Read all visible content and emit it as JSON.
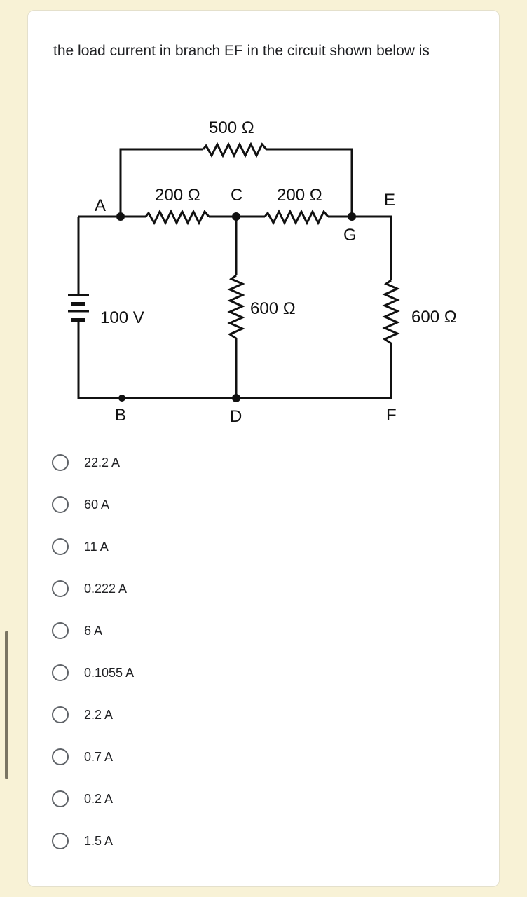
{
  "question": {
    "text": "the load current in branch EF in the circuit shown below is"
  },
  "circuit": {
    "source": {
      "label": "100 V"
    },
    "resistors": {
      "top": "500 Ω",
      "ac": "200 Ω",
      "cg": "200 Ω",
      "cd": "600 Ω",
      "ef": "600 Ω"
    },
    "nodes": {
      "a": "A",
      "b": "B",
      "c": "C",
      "d": "D",
      "e": "E",
      "f": "F",
      "g": "G"
    }
  },
  "options": [
    {
      "label": "22.2 A",
      "selected": false
    },
    {
      "label": "60 A",
      "selected": false
    },
    {
      "label": "11 A",
      "selected": false
    },
    {
      "label": "0.222 A",
      "selected": false
    },
    {
      "label": "6 A",
      "selected": false
    },
    {
      "label": "0.1055 A",
      "selected": false
    },
    {
      "label": "2.2 A",
      "selected": false
    },
    {
      "label": "0.7 A",
      "selected": false
    },
    {
      "label": "0.2 A",
      "selected": false
    },
    {
      "label": "1.5 A",
      "selected": false
    }
  ],
  "colors": {
    "page_background": "#f8f2d6",
    "card_background": "#ffffff",
    "radio_border": "#5f6368",
    "text": "#202124"
  }
}
